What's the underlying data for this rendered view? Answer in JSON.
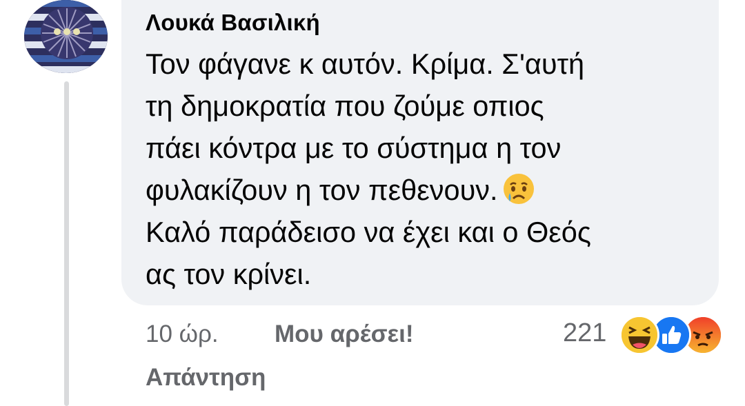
{
  "comment": {
    "author": "Λουκά Βασιλική",
    "lines": [
      "Τον φάγανε κ αυτόν. Κρίμα. Σ'αυτή",
      "τη δημοκρατία που ζούμε οπιος",
      "πάει κόντρα με το σύστημα η τον",
      "φυλακίζουν η τον πεθενουν.",
      "Καλό παράδεισο να έχει και ο Θεός",
      "ας τον κρίνει."
    ],
    "inline_emoji": "sad-crying-emoji",
    "timestamp": "10 ώρ.",
    "like_label": "Μου αρέσει!",
    "reply_label": "Απάντηση",
    "reaction_count": "221",
    "reactions": [
      "haha-icon",
      "like-icon",
      "angry-icon"
    ]
  },
  "colors": {
    "bubble": "#f0f2f5",
    "meta_text": "#65676b",
    "like_blue": "#1877f2",
    "haha_yellow": "#f7c531",
    "angry_orange": "#e8572b"
  }
}
